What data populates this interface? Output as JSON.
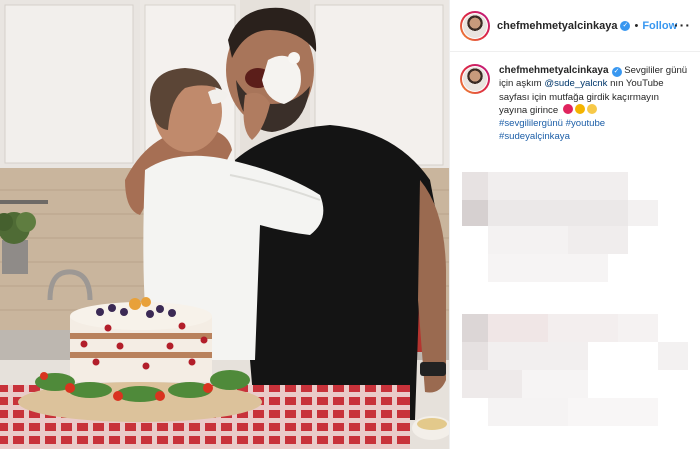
{
  "post": {
    "username": "chefmehmetyalcinkaya",
    "verified_icon": "verified-badge-icon",
    "separator": "•",
    "follow_label": "Follow",
    "more_label": "···"
  },
  "caption": {
    "username": "chefmehmetyalcinkaya",
    "line1": "Sevgililer günü için aşkım",
    "mention": "@sude_yalcnk",
    "line2": "nın YouTube sayfası için mutfağa girdik kaçırmayın yayına girince",
    "tag1": "#sevgililergünü",
    "tag2": "#youtube",
    "tag3": "#sudeyalçinkaya"
  },
  "colors": {
    "accent": "#3897f0",
    "link": "#00376b",
    "tablecloth": "#c8323a"
  }
}
